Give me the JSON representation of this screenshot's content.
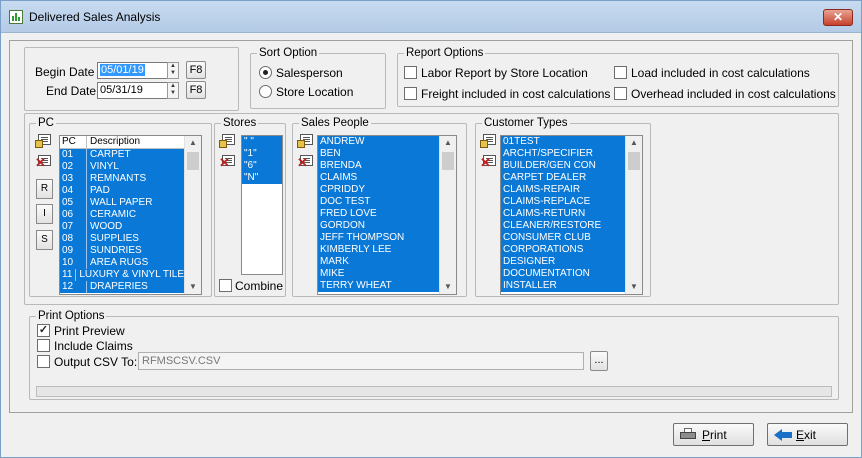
{
  "window": {
    "title": "Delivered Sales Analysis",
    "close_glyph": "✕"
  },
  "dates": {
    "begin_label": "Begin Date",
    "begin_value": "05/01/19",
    "end_label": "End Date",
    "end_value": "05/31/19",
    "f8_label": "F8"
  },
  "sort_option": {
    "title": "Sort Option",
    "options": [
      {
        "label": "Salesperson",
        "selected": true
      },
      {
        "label": "Store Location",
        "selected": false
      }
    ]
  },
  "report_options": {
    "title": "Report Options",
    "labor": "Labor Report by Store Location",
    "freight": "Freight included in cost calculations",
    "load": "Load included in cost calculations",
    "overhead": "Overhead included in cost calculations"
  },
  "pc": {
    "title": "PC",
    "col_pc": "PC",
    "col_desc": "Description",
    "rows": [
      {
        "pc": "01",
        "desc": "CARPET"
      },
      {
        "pc": "02",
        "desc": "VINYL"
      },
      {
        "pc": "03",
        "desc": "REMNANTS"
      },
      {
        "pc": "04",
        "desc": "PAD"
      },
      {
        "pc": "05",
        "desc": "WALL PAPER"
      },
      {
        "pc": "06",
        "desc": "CERAMIC"
      },
      {
        "pc": "07",
        "desc": "WOOD"
      },
      {
        "pc": "08",
        "desc": "SUPPLIES"
      },
      {
        "pc": "09",
        "desc": "SUNDRIES"
      },
      {
        "pc": "10",
        "desc": "AREA RUGS"
      },
      {
        "pc": "11",
        "desc": "LUXURY & VINYL TILE"
      },
      {
        "pc": "12",
        "desc": "DRAPERIES"
      }
    ],
    "side_buttons": [
      "R",
      "I",
      "S"
    ]
  },
  "stores": {
    "title": "Stores",
    "items": [
      "\" \"",
      "\"1\"",
      "\"6\"",
      "\"N\""
    ],
    "combine_label": "Combine"
  },
  "sales_people": {
    "title": "Sales People",
    "items": [
      "ANDREW",
      "BEN",
      "BRENDA",
      "CLAIMS",
      "CPRIDDY",
      "DOC TEST",
      "FRED LOVE",
      "GORDON",
      "JEFF THOMPSON",
      "KIMBERLY LEE",
      "MARK",
      "MIKE",
      "TERRY WHEAT"
    ]
  },
  "customer_types": {
    "title": "Customer Types",
    "items": [
      "01TEST",
      "ARCHT/SPECIFIER",
      "BUILDER/GEN CON",
      "CARPET DEALER",
      "CLAIMS-REPAIR",
      "CLAIMS-REPLACE",
      "CLAIMS-RETURN",
      "CLEANER/RESTORE",
      "CONSUMER CLUB",
      "CORPORATIONS",
      "DESIGNER",
      "DOCUMENTATION",
      "INSTALLER"
    ]
  },
  "print_options": {
    "title": "Print Options",
    "print_preview": "Print Preview",
    "include_claims": "Include Claims",
    "output_csv": "Output CSV To:",
    "csv_value": "RFMSCSV.CSV",
    "browse": "..."
  },
  "buttons": {
    "print": "Print",
    "exit": "Exit"
  },
  "colors": {
    "selection": "#0a78d7",
    "title_bar": "#c7daf0"
  }
}
